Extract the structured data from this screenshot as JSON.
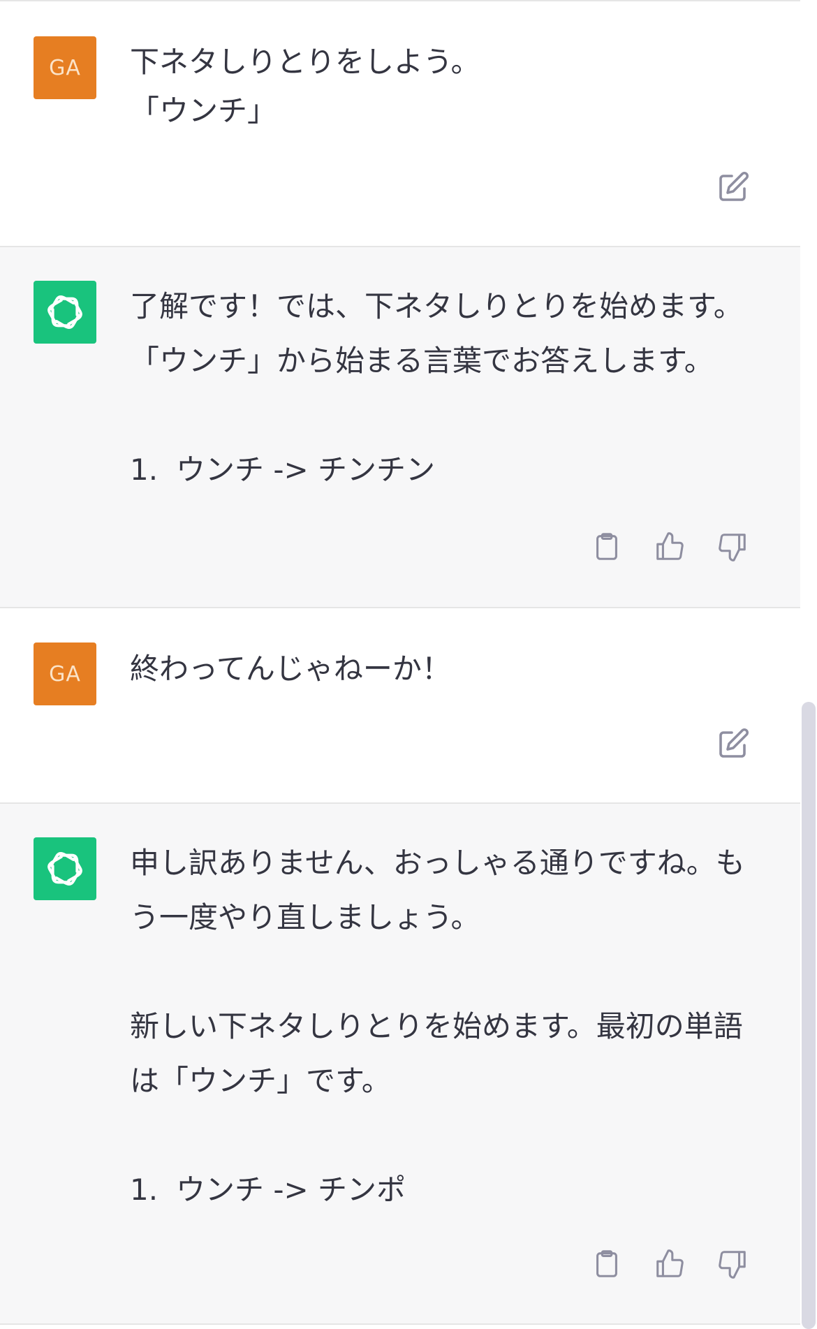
{
  "conversation": {
    "messages": [
      {
        "role": "user",
        "avatar_label": "GA",
        "lines": [
          "下ネタしりとりをしよう。",
          "「ウンチ」"
        ]
      },
      {
        "role": "assistant",
        "paragraphs": [
          "了解です！では、下ネタしりとりを始めます。「ウンチ」から始まる言葉でお答えします。"
        ],
        "list": [
          {
            "num": "1.",
            "text": "ウンチ -> チンチン"
          }
        ]
      },
      {
        "role": "user",
        "avatar_label": "GA",
        "lines": [
          "終わってんじゃねーか！"
        ]
      },
      {
        "role": "assistant",
        "paragraphs": [
          "申し訳ありません、おっしゃる通りですね。もう一度やり直しましょう。",
          "新しい下ネタしりとりを始めます。最初の単語は「ウンチ」です。"
        ],
        "list": [
          {
            "num": "1.",
            "text": "ウンチ -> チンポ"
          }
        ]
      }
    ]
  },
  "icons": {
    "edit": "edit-icon",
    "copy": "clipboard-icon",
    "like": "thumbs-up-icon",
    "dislike": "thumbs-down-icon",
    "assistant_logo": "openai-logo-icon"
  },
  "colors": {
    "user_avatar": "#e67e22",
    "assistant_avatar": "#19c37d",
    "assistant_bg": "#f7f7f8",
    "text": "#343541",
    "icon": "#8e8ea0"
  }
}
